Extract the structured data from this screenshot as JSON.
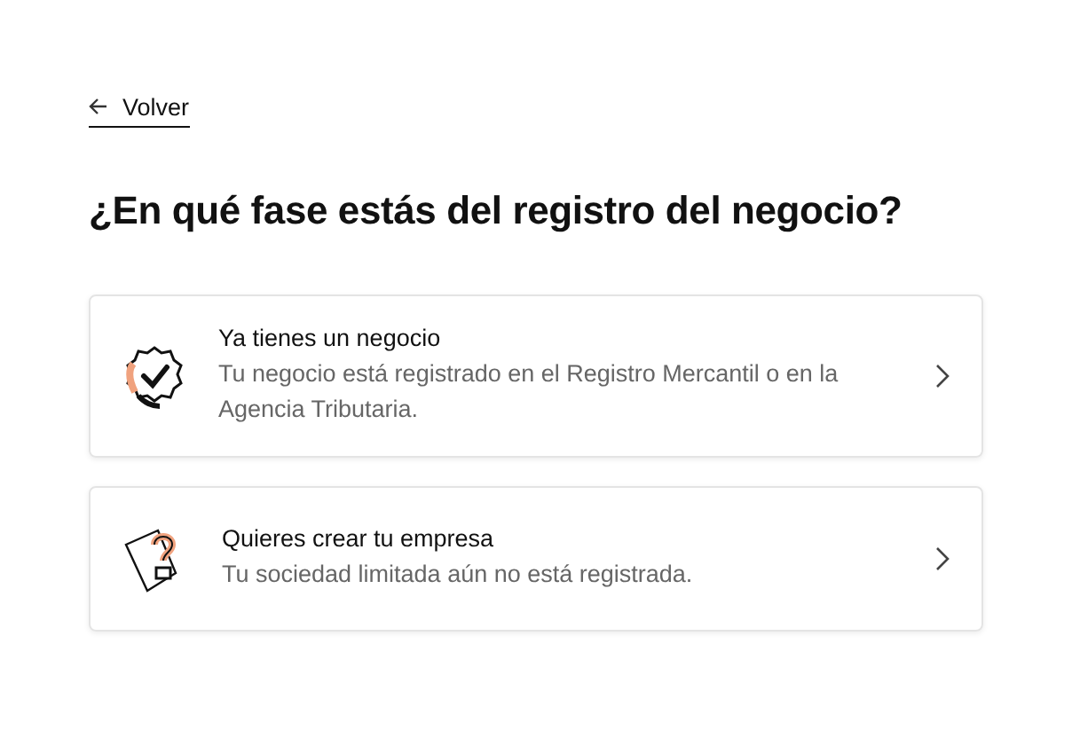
{
  "back_link": {
    "label": "Volver"
  },
  "title": "¿En qué fase estás del registro del negocio?",
  "options": [
    {
      "kind": "badge",
      "title": "Ya tienes un negocio",
      "description": "Tu negocio está registrado en el Registro Mercantil o en la Agencia Tributaria."
    },
    {
      "kind": "question",
      "title": "Quieres crear tu empresa",
      "description": "Tu sociedad limitada aún no está registrada."
    }
  ]
}
